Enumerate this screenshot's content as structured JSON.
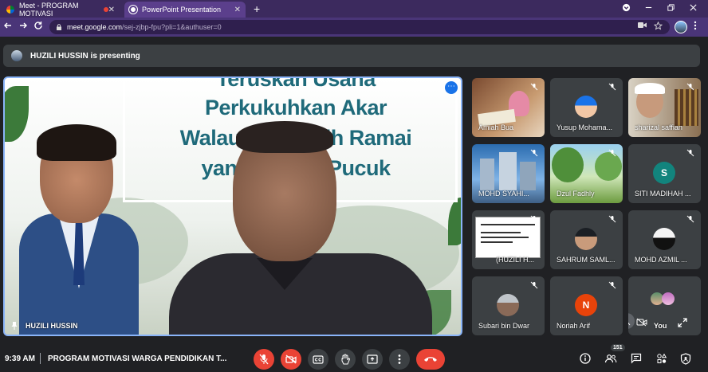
{
  "browser": {
    "tabs": [
      {
        "label": "Meet - PROGRAM MOTIVASI",
        "close": "✕"
      },
      {
        "label": "PowerPoint Presentation",
        "close": "✕"
      }
    ],
    "new_tab": "+",
    "url_host": "meet.google.com",
    "url_path": "/sej-zjbp-fpu?pli=1&authuser=0"
  },
  "presenting_banner": "HUZILI HUSSIN is presenting",
  "main_tile": {
    "slide_lines": [
      "Teruskan Usaha",
      "Perkukuhkan Akar",
      "Walaupun Masih Ramai",
      "yang Disiasi Pucuk"
    ],
    "name": "HUZILI HUSSIN"
  },
  "participants": [
    {
      "name": "Amiah Bua"
    },
    {
      "name": "Yusup Mohama..."
    },
    {
      "name": "sharizal saffian"
    },
    {
      "name": "MOHD SYAHI..."
    },
    {
      "name": "Dzul Fadhly"
    },
    {
      "name": "SITI MADIHAH ...",
      "initial": "S"
    },
    {
      "name": "(HUZILI H..."
    },
    {
      "name": "SAHRUM SAML..."
    },
    {
      "name": "MOHD AZMIL ..."
    },
    {
      "name": "Subari bin Dwar"
    },
    {
      "name": "Noriah Arif",
      "initial": "N"
    },
    {
      "name": "You"
    }
  ],
  "bottom": {
    "time": "9:39 AM",
    "separator": "|",
    "meeting_title": "PROGRAM MOTIVASI WARGA PENDIDIKAN T...",
    "participant_count": "151"
  },
  "colors": {
    "tab_bar": "#3c2a5e",
    "active_tab": "#5b3f8c",
    "highlight": "#8ab4f8",
    "end_call": "#ea4335",
    "tile": "#3c4043",
    "background": "#202124"
  }
}
